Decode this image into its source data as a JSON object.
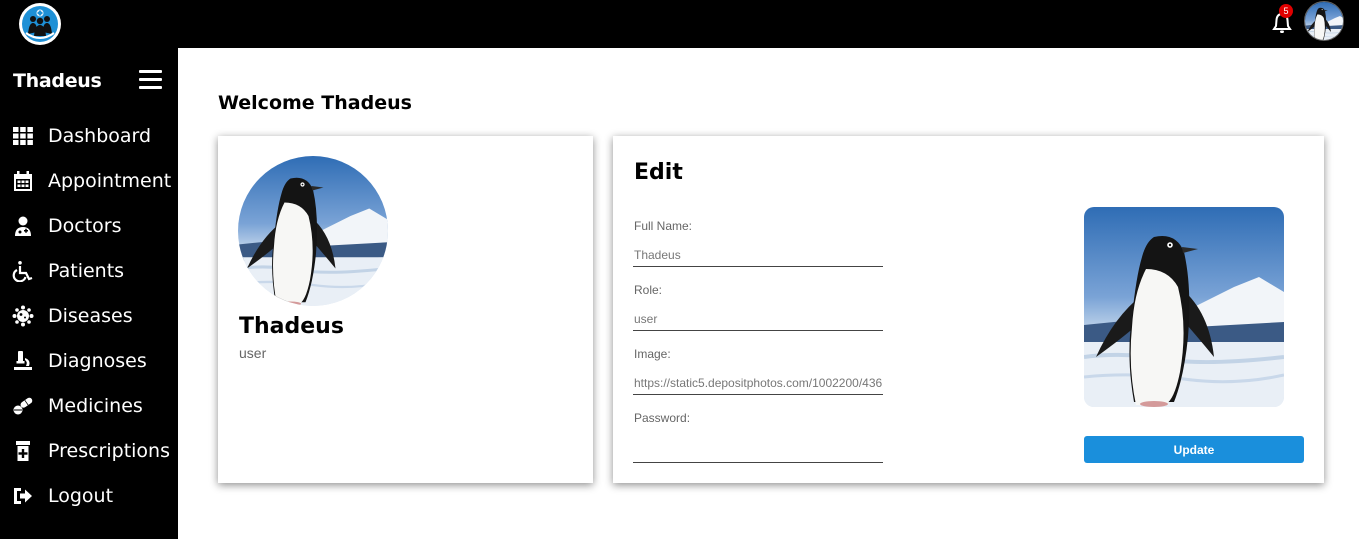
{
  "header": {
    "notification_count": "5",
    "logo_icon": "medical-group-logo",
    "bell_icon": "bell-icon",
    "avatar_icon": "penguin-avatar"
  },
  "sidebar": {
    "username": "Thadeus",
    "menu_icon": "hamburger-icon",
    "items": [
      {
        "label": "Dashboard",
        "icon": "grid-icon"
      },
      {
        "label": "Appointment",
        "icon": "calendar-icon"
      },
      {
        "label": "Doctors",
        "icon": "doctor-icon"
      },
      {
        "label": "Patients",
        "icon": "wheelchair-icon"
      },
      {
        "label": "Diseases",
        "icon": "virus-icon"
      },
      {
        "label": "Diagnoses",
        "icon": "microscope-icon"
      },
      {
        "label": "Medicines",
        "icon": "pills-icon"
      },
      {
        "label": "Prescriptions",
        "icon": "prescription-bottle-icon"
      },
      {
        "label": "Logout",
        "icon": "logout-icon"
      }
    ]
  },
  "main": {
    "welcome": "Welcome Thadeus",
    "profile": {
      "name": "Thadeus",
      "role": "user"
    },
    "edit": {
      "title": "Edit",
      "fields": {
        "full_name": {
          "label": "Full Name:",
          "value": "Thadeus"
        },
        "role": {
          "label": "Role:",
          "value": "user"
        },
        "image": {
          "label": "Image:",
          "value": "https://static5.depositphotos.com/1002200/436/i/450/depositphotos_4369052-stock-photo-adelie-penguin.jpg"
        },
        "password": {
          "label": "Password:",
          "value": ""
        }
      },
      "update_label": "Update"
    }
  },
  "colors": {
    "topbar": "#000000",
    "sidebar": "#000000",
    "accent": "#1a8fdc",
    "badge": "#e00000"
  }
}
